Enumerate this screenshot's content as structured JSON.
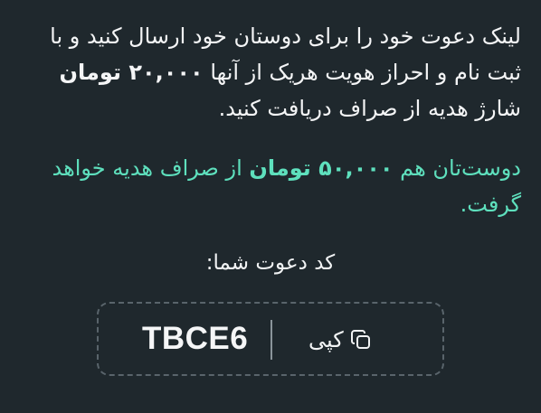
{
  "invite": {
    "p1_a": "لینک دعوت خود را برای دوستان خود ارسال کنید و با ثبت نام و احراز هویت هریک از آنها ",
    "p1_amount": "۲۰,۰۰۰ تومان",
    "p1_b": " شارژ هدیه از صراف دریافت کنید.",
    "p2_a": "دوست‌تان هم ",
    "p2_amount": "۵۰,۰۰۰ تومان",
    "p2_b": " از صراف هدیه خواهد گرفت.",
    "code_label": "کد دعوت شما:",
    "code": "TBCE6",
    "copy_label": "کپی"
  }
}
